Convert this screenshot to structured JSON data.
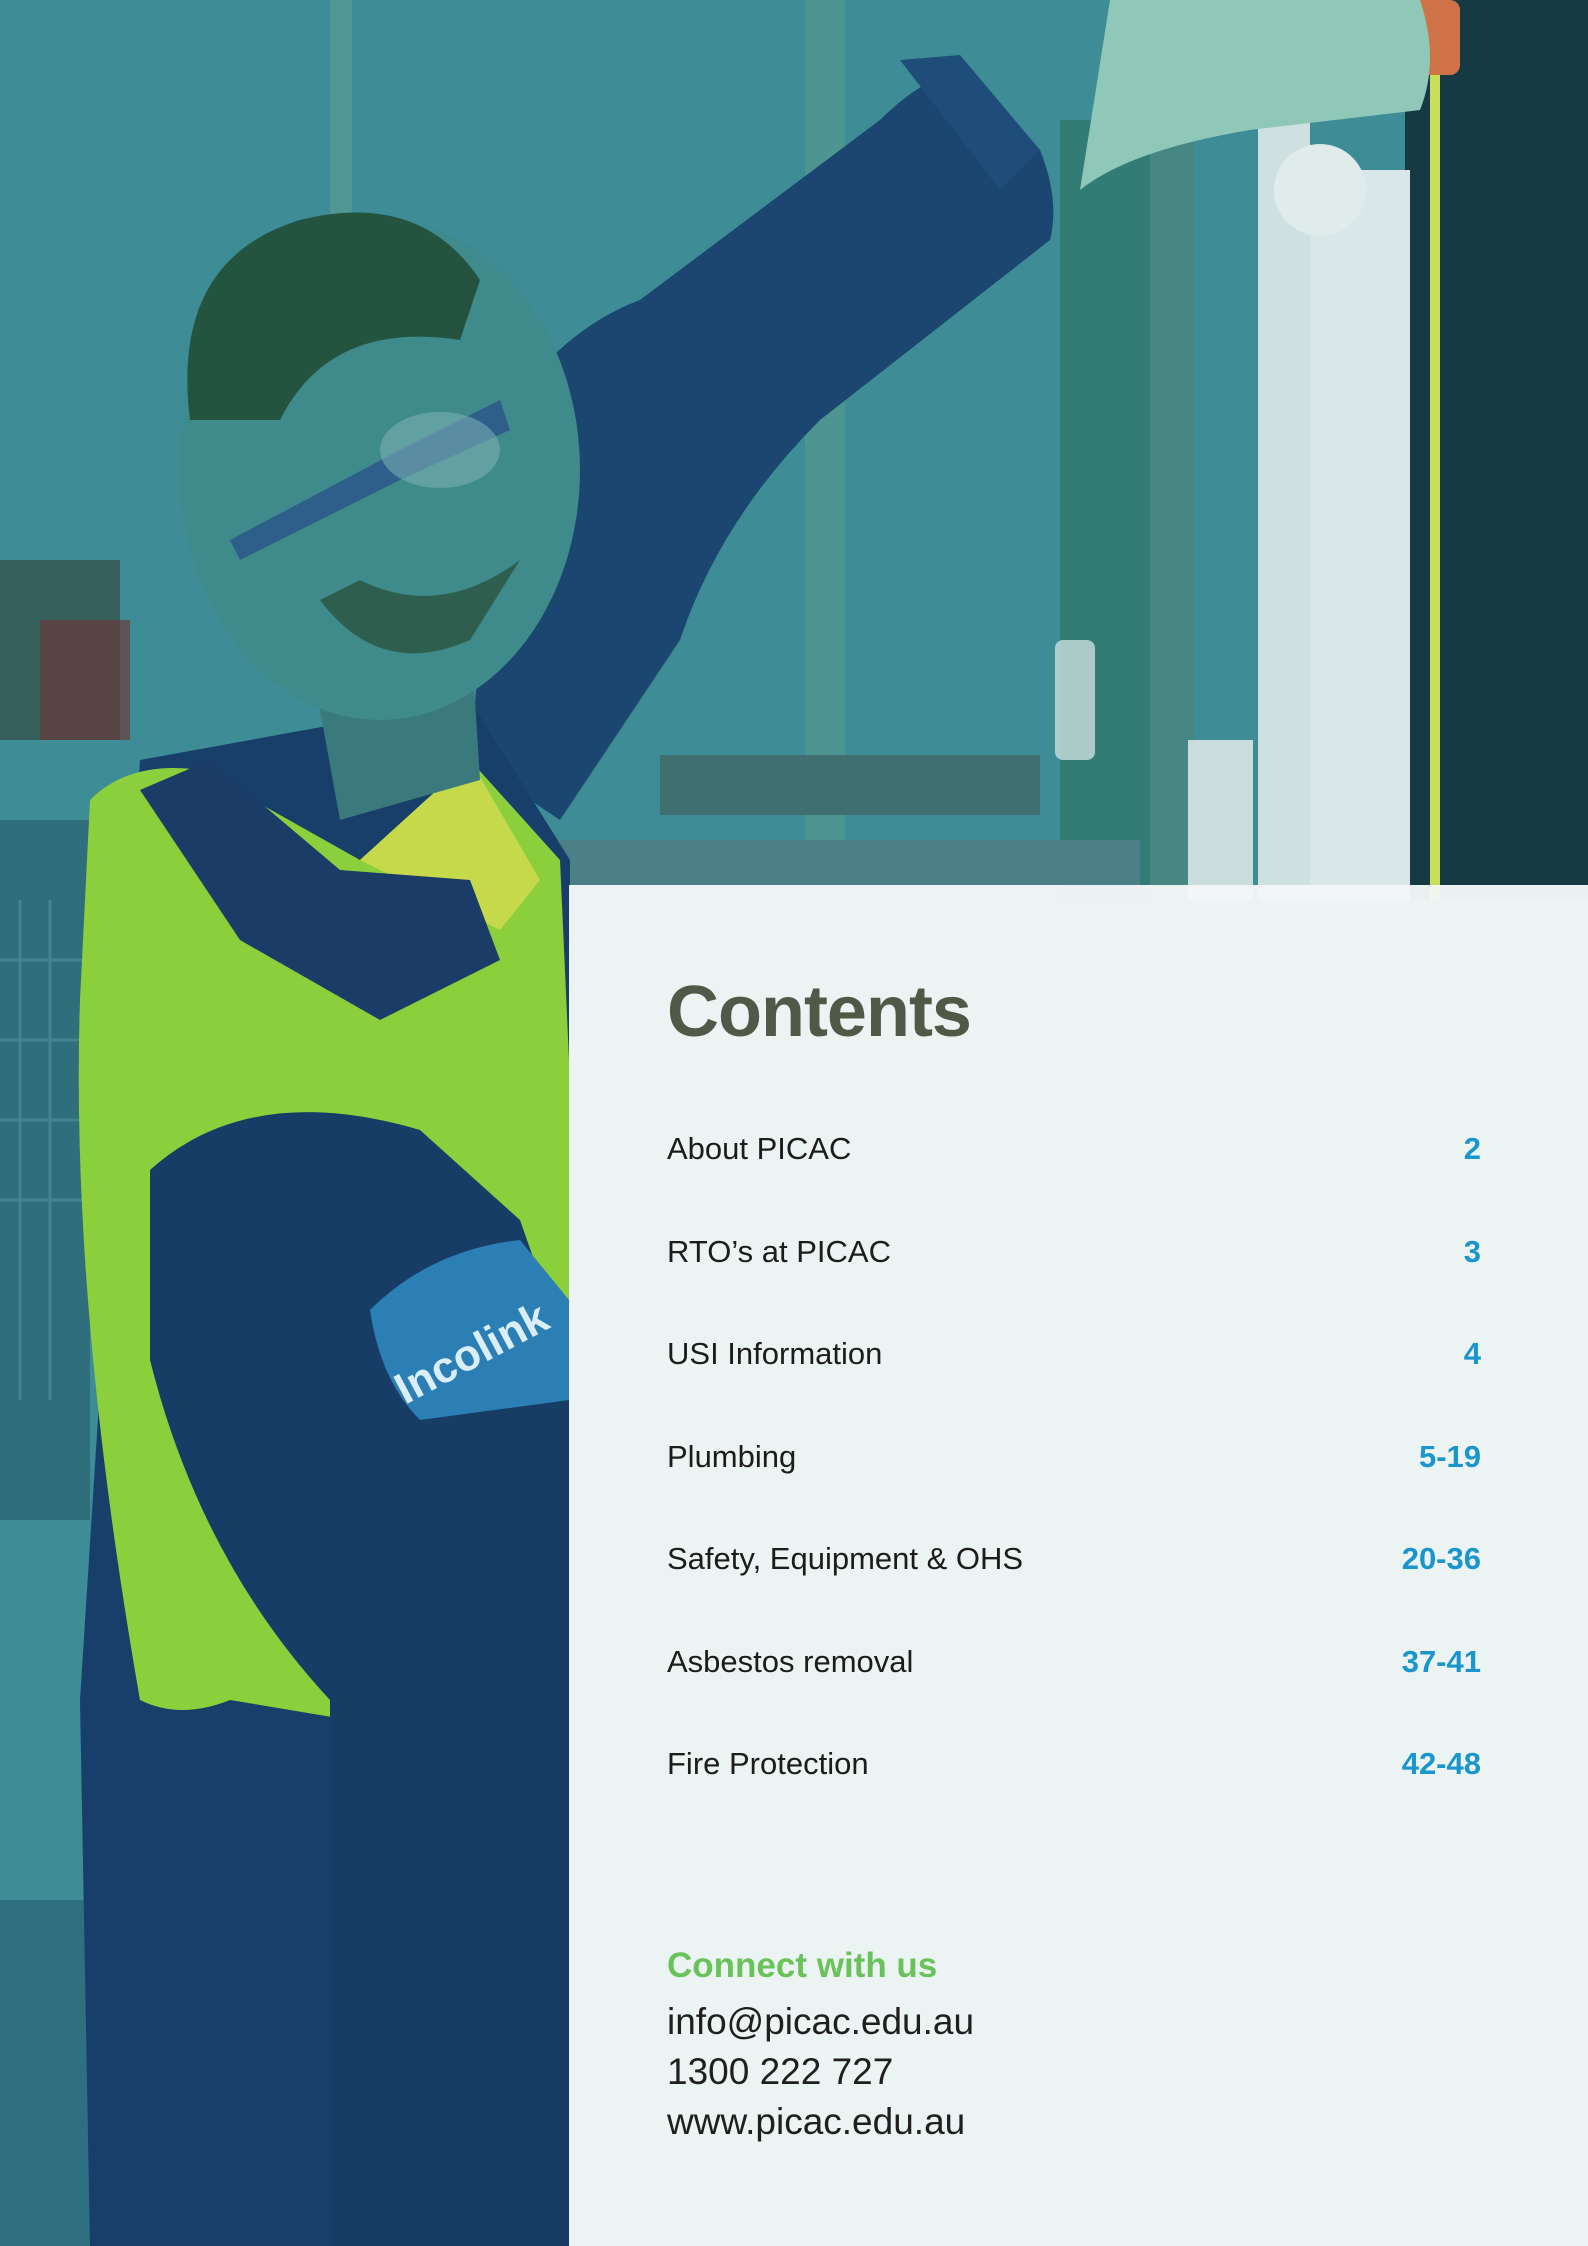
{
  "contents": {
    "title": "Contents",
    "items": [
      {
        "label": "About PICAC",
        "page": "2"
      },
      {
        "label": "RTO’s at PICAC",
        "page": "3"
      },
      {
        "label": "USI Information",
        "page": "4"
      },
      {
        "label": "Plumbing",
        "page": "5-19"
      },
      {
        "label": "Safety, Equipment & OHS",
        "page": "20-36"
      },
      {
        "label": "Asbestos removal",
        "page": "37-41"
      },
      {
        "label": "Fire Protection",
        "page": "42-48"
      }
    ]
  },
  "connect": {
    "heading": "Connect with us",
    "email": "info@picac.edu.au",
    "phone": "1300 222 727",
    "website": "www.picac.edu.au"
  },
  "hero": {
    "sleeve_logo_text": "Incolink"
  },
  "colors": {
    "title": "#4e5a47",
    "page_numbers": "#1a96cc",
    "connect_heading": "#6ac35a",
    "hi_vis": "#8ccf3c",
    "shirt": "#173f6a"
  }
}
